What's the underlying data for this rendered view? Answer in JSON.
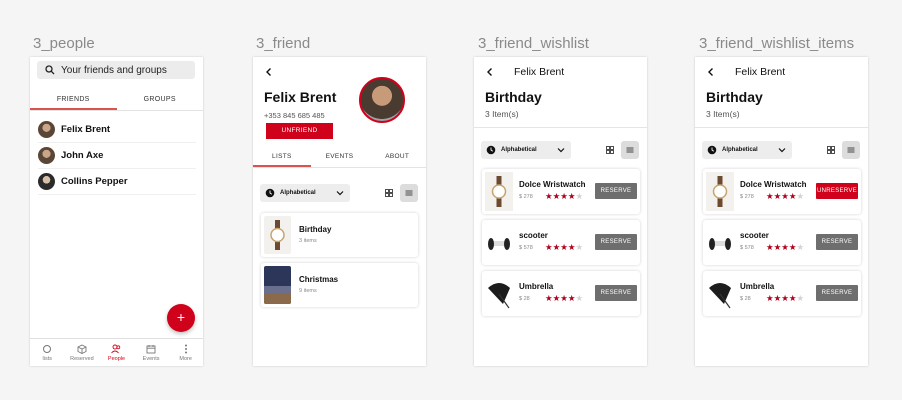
{
  "frames": [
    {
      "title": "3_people"
    },
    {
      "title": "3_friend"
    },
    {
      "title": "3_friend_wishlist"
    },
    {
      "title": "3_friend_wishlist_items"
    }
  ],
  "people": {
    "search_placeholder": "Your friends and groups",
    "tabs": [
      "FRIENDS",
      "GROUPS"
    ],
    "friends": [
      "Felix Brent",
      "John Axe",
      "Collins Pepper"
    ],
    "fab": "+",
    "nav": [
      "lists",
      "Reserved",
      "People",
      "Events",
      "More"
    ]
  },
  "friend": {
    "name": "Felix Brent",
    "phone": "+353 845 685 485",
    "unfriend": "UNFRIEND",
    "tabs": [
      "LISTS",
      "EVENTS",
      "ABOUT"
    ],
    "sort": "Alphabetical",
    "wishlists": [
      {
        "name": "Birthday",
        "count": "3 items"
      },
      {
        "name": "Christmas",
        "count": "9 items"
      }
    ]
  },
  "wishlist": {
    "header": "Felix Brent",
    "title": "Birthday",
    "count": "3 Item(s)",
    "sort": "Alphabetical",
    "items": [
      {
        "name": "Dolce Wristwatch",
        "price": "$ 278",
        "rating": 4,
        "action": "RESERVE"
      },
      {
        "name": "scooter",
        "price": "$ 578",
        "rating": 4,
        "action": "RESERVE"
      },
      {
        "name": "Umbrella",
        "price": "$ 28",
        "rating": 4,
        "action": "RESERVE"
      }
    ]
  },
  "wishlist_items": {
    "header": "Felix Brent",
    "title": "Birthday",
    "count": "3 Item(s)",
    "sort": "Alphabetical",
    "items": [
      {
        "name": "Dolce Wristwatch",
        "price": "$ 278",
        "rating": 4,
        "action": "UNRESERVE"
      },
      {
        "name": "scooter",
        "price": "$ 578",
        "rating": 4,
        "action": "RESERVE"
      },
      {
        "name": "Umbrella",
        "price": "$ 28",
        "rating": 4,
        "action": "RESERVE"
      }
    ]
  },
  "colors": {
    "accent": "#d0021b",
    "reserve_gray": "#6e6e6e",
    "star": "#b0001a"
  },
  "icons": {
    "search": "search-icon",
    "back": "back-arrow-icon",
    "clock": "clock-icon",
    "grid": "grid-view-icon",
    "list": "list-view-icon"
  }
}
